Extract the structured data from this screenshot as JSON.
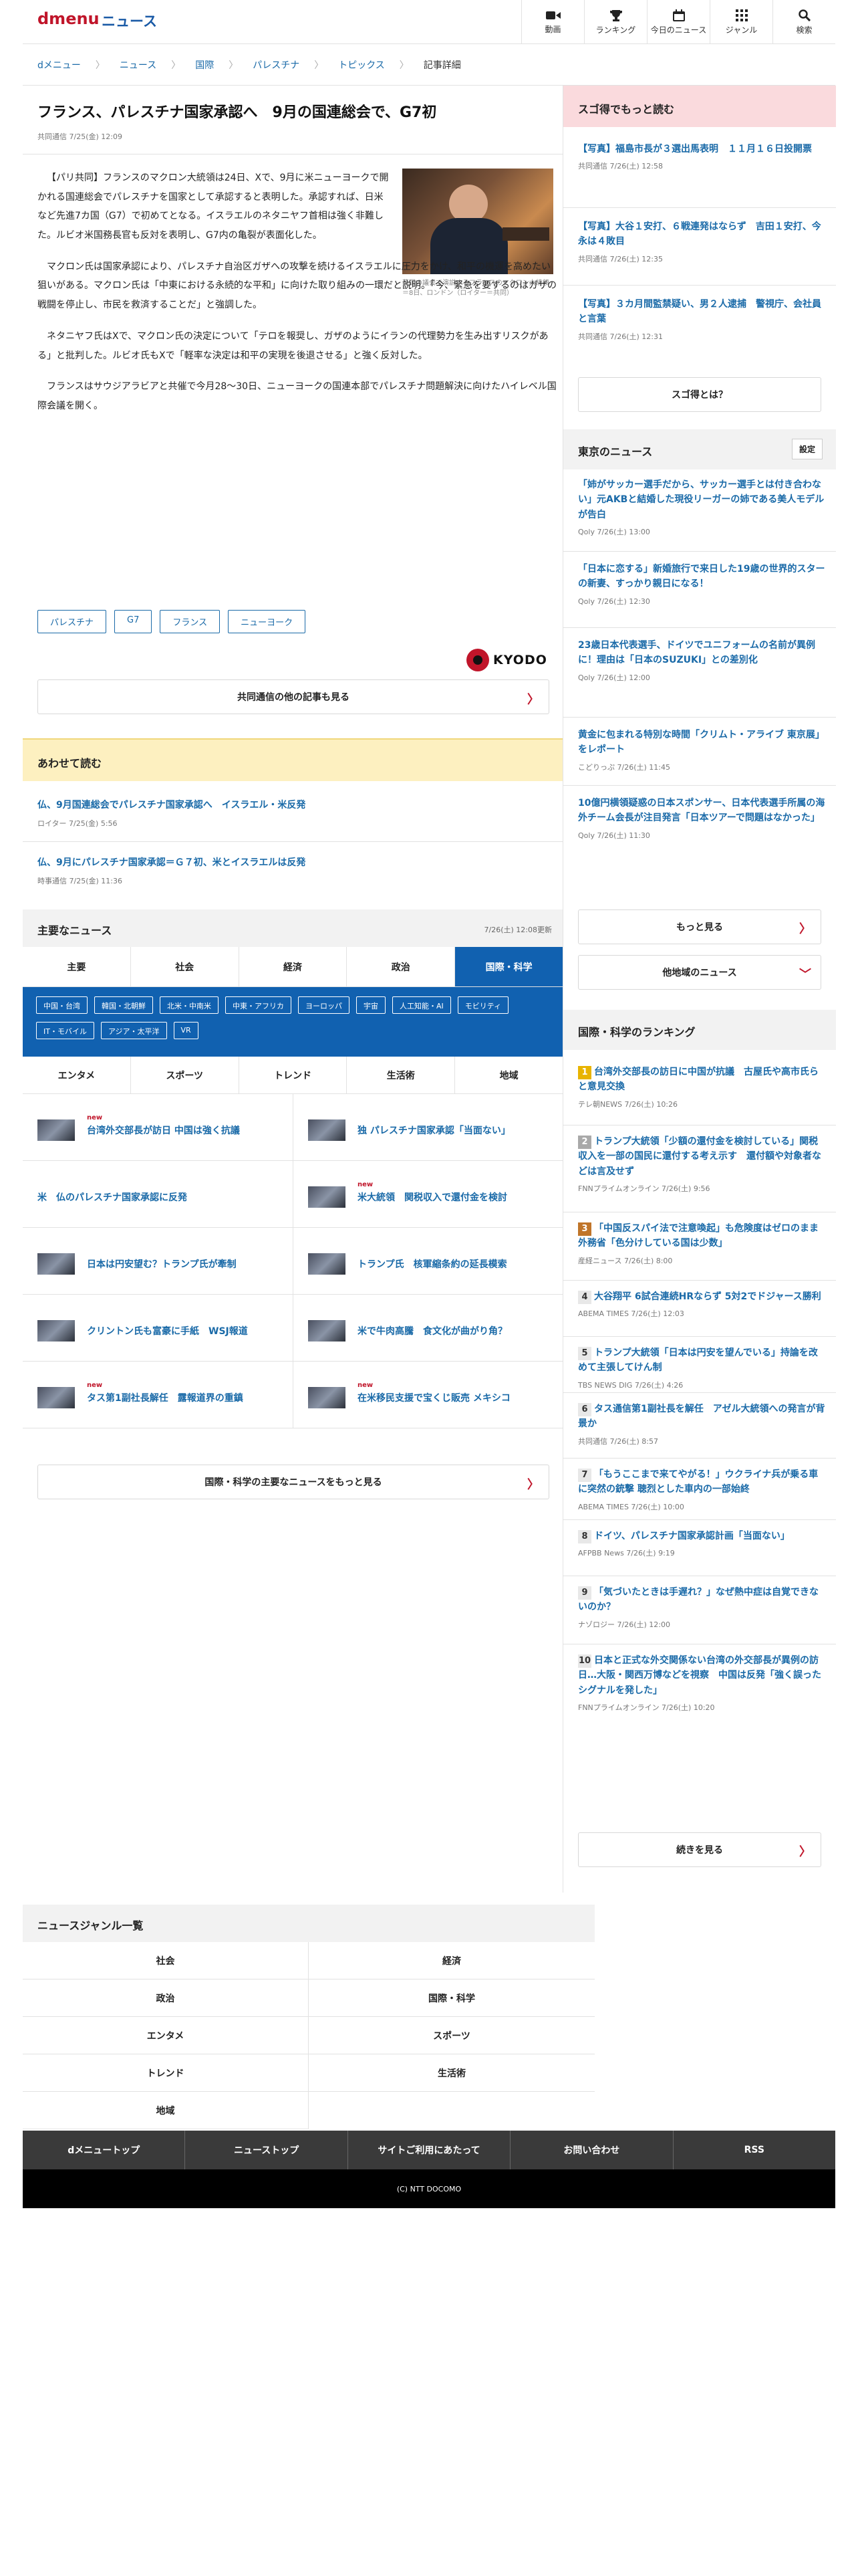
{
  "header": {
    "logo": "dmenu",
    "section": "ニュース",
    "nav": [
      {
        "label": "動画",
        "icon": "video-icon"
      },
      {
        "label": "ランキング",
        "icon": "trophy-icon"
      },
      {
        "label": "今日のニュース",
        "icon": "calendar-icon"
      },
      {
        "label": "ジャンル",
        "icon": "grid-icon"
      },
      {
        "label": "検索",
        "icon": "search-icon"
      }
    ]
  },
  "breadcrumb": [
    "dメニュー",
    "ニュース",
    "国際",
    "パレスチナ",
    "トピックス",
    "記事詳細"
  ],
  "article": {
    "title": "フランス、パレスチナ国家承認へ　9月の国連総会で、G7初",
    "meta": "共同通信 7/25(金) 12:09",
    "photo_caption": "英国の議会で演説するフランスのマクロン大統領＝8日、ロンドン（ロイター＝共同）",
    "paragraphs": [
      "【パリ共同】フランスのマクロン大統領は24日、Xで、9月に米ニューヨークで開かれる国連総会でパレスチナを国家として承認すると表明した。承認すれば、日米など先進7カ国（G7）で初めてとなる。イスラエルのネタニヤフ首相は強く非難した。ルビオ米国務長官も反対を表明し、G7内の亀裂が表面化した。",
      "マクロン氏は国家承認により、パレスチナ自治区ガザへの攻撃を続けるイスラエルに圧力をかけ、和平の機運を高めたい狙いがある。マクロン氏は「中東における永続的な平和」に向けた取り組みの一環だと説明。「今、緊急を要するのはガザの戦闘を停止し、市民を救済することだ」と強調した。",
      "ネタニヤフ氏はXで、マクロン氏の決定について「テロを報奨し、ガザのようにイランの代理勢力を生み出すリスクがある」と批判した。ルビオ氏もXで「軽率な決定は和平の実現を後退させる」と強く反対した。",
      "フランスはサウジアラビアと共催で今月28〜30日、ニューヨークの国連本部でパレスチナ問題解決に向けたハイレベル国際会議を開く。"
    ],
    "tags": [
      "パレスチナ",
      "G7",
      "フランス",
      "ニューヨーク"
    ],
    "source_logo": "KYODO",
    "more_button": "共同通信の他の記事も見る"
  },
  "related": {
    "title": "あわせて読む",
    "items": [
      {
        "title": "仏、9月国連総会でパレスチナ国家承認へ　イスラエル・米反発",
        "meta": "ロイター 7/25(金) 5:56"
      },
      {
        "title": "仏、9月にパレスチナ国家承認＝Ｇ７初、米とイスラエルは反発",
        "meta": "時事通信 7/25(金) 11:36"
      }
    ]
  },
  "major": {
    "title": "主要なニュース",
    "updated": "7/26(土) 12:08更新",
    "tabs1": [
      "主要",
      "社会",
      "経済",
      "政治",
      "国際・科学"
    ],
    "active_tab": "国際・科学",
    "subtags": [
      "中国・台湾",
      "韓国・北朝鮮",
      "北米・中南米",
      "中東・アフリカ",
      "ヨーロッパ",
      "宇宙",
      "人工知能・AI",
      "モビリティ",
      "IT・モバイル",
      "アジア・太平洋",
      "VR"
    ],
    "tabs2": [
      "エンタメ",
      "スポーツ",
      "トレンド",
      "生活術",
      "地域"
    ],
    "new_label": "new",
    "items": [
      {
        "title": "台湾外交部長が訪日 中国は強く抗議",
        "new": true,
        "thumb": true
      },
      {
        "title": "独 パレスチナ国家承認「当面ない」",
        "new": false,
        "thumb": true
      },
      {
        "title": "米　仏のパレスチナ国家承認に反発",
        "new": false,
        "thumb": false
      },
      {
        "title": "米大統領　関税収入で還付金を検討",
        "new": true,
        "thumb": true
      },
      {
        "title": "日本は円安望む？トランプ氏が牽制",
        "new": false,
        "thumb": true
      },
      {
        "title": "トランプ氏　核軍縮条約の延長模索",
        "new": false,
        "thumb": true
      },
      {
        "title": "クリントン氏も富豪に手紙　WSJ報道",
        "new": false,
        "thumb": true
      },
      {
        "title": "米で牛肉高騰　食文化が曲がり角？",
        "new": false,
        "thumb": true
      },
      {
        "title": "タス第1副社長解任　露報道界の重鎮",
        "new": true,
        "thumb": true
      },
      {
        "title": "在米移民支援で宝くじ販売 メキシコ",
        "new": true,
        "thumb": true
      }
    ],
    "more_button": "国際・科学の主要なニュースをもっと見る"
  },
  "sidebar": {
    "sugotoku": {
      "title": "スゴ得でもっと読む",
      "items": [
        {
          "title": "【写真】福島市長が３選出馬表明　１１月１６日投開票",
          "meta": "共同通信 7/26(土) 12:58"
        },
        {
          "title": "【写真】大谷１安打、６戦連発はならず　吉田１安打、今永は４敗目",
          "meta": "共同通信 7/26(土) 12:35"
        },
        {
          "title": "【写真】３カ月間監禁疑い、男２人逮捕　警視庁、会社員と言葉",
          "meta": "共同通信 7/26(土) 12:31"
        }
      ],
      "button": "スゴ得とは？"
    },
    "tokyo": {
      "title": "東京のニュース",
      "settings": "設定",
      "items": [
        {
          "title": "「姉がサッカー選手だから、サッカー選手とは付き合わない」元AKBと結婚した現役リーガーの姉である美人モデルが告白",
          "meta": "Qoly 7/26(土) 13:00"
        },
        {
          "title": "「日本に恋する」新婚旅行で来日した19歳の世界的スターの新妻、すっかり親日になる！",
          "meta": "Qoly 7/26(土) 12:30"
        },
        {
          "title": "23歳日本代表選手、ドイツでユニフォームの名前が異例に！理由は「日本のSUZUKI」との差別化",
          "meta": "Qoly 7/26(土) 12:00"
        },
        {
          "title": "黄金に包まれる特別な時間「クリムト・アライブ 東京展」をレポート",
          "meta": "こどりっぷ 7/26(土) 11:45"
        },
        {
          "title": "10億円横領疑惑の日本スポンサー、日本代表選手所属の海外チーム会長が注目発言「日本ツアーで問題はなかった」",
          "meta": "Qoly 7/26(土) 11:30"
        }
      ],
      "more_button": "もっと見る",
      "other_button": "他地域のニュース"
    },
    "ranking": {
      "title": "国際・科学のランキング",
      "items": [
        {
          "rank": "1",
          "title": "台湾外交部長の訪日に中国が抗議　古屋氏や高市氏らと意見交換",
          "meta": "テレ朝NEWS 7/26(土) 10:26"
        },
        {
          "rank": "2",
          "title": "トランプ大統領「少額の還付金を検討している」関税収入を一部の国民に還付する考え示す　還付額や対象者などは言及せず",
          "meta": "FNNプライムオンライン 7/26(土) 9:56"
        },
        {
          "rank": "3",
          "title": "「中国反スパイ法で注意喚起」も危険度はゼロのまま　外務省「色分けしている国は少数」",
          "meta": "産経ニュース 7/26(土) 8:00"
        },
        {
          "rank": "4",
          "title": "大谷翔平 6試合連続HRならず 5対2でドジャース勝利",
          "meta": "ABEMA TIMES 7/26(土) 12:03"
        },
        {
          "rank": "5",
          "title": "トランプ大統領「日本は円安を望んでいる」持論を改めて主張してけん制",
          "meta": "TBS NEWS DIG 7/26(土) 4:26"
        },
        {
          "rank": "6",
          "title": "タス通信第1副社長を解任　アゼル大統領への発言が背景か",
          "meta": "共同通信 7/26(土) 8:57"
        },
        {
          "rank": "7",
          "title": "「もうここまで来てやがる！」ウクライナ兵が乗る車に突然の銃撃 聴烈とした車内の一部始終",
          "meta": "ABEMA TIMES 7/26(土) 10:00"
        },
        {
          "rank": "8",
          "title": "ドイツ、パレスチナ国家承認計画「当面ない」",
          "meta": "AFPBB News 7/26(土) 9:19"
        },
        {
          "rank": "9",
          "title": "「気づいたときは手遅れ？」なぜ熱中症は自覚できないのか？",
          "meta": "ナゾロジー 7/26(土) 12:00"
        },
        {
          "rank": "10",
          "title": "日本と正式な外交関係ない台湾の外交部長が異例の訪日…大阪・関西万博などを視察　中国は反発「強く誤ったシグナルを発した」",
          "meta": "FNNプライムオンライン 7/26(土) 10:20"
        }
      ],
      "button": "続きを見る"
    }
  },
  "genres": {
    "title": "ニュースジャンル一覧",
    "items": [
      "社会",
      "経済",
      "政治",
      "国際・科学",
      "エンタメ",
      "スポーツ",
      "トレンド",
      "生活術",
      "地域"
    ]
  },
  "footer": {
    "links": [
      "dメニュートップ",
      "ニューストップ",
      "サイトご利用にあたって",
      "お問い合わせ",
      "RSS"
    ],
    "copyright": "(C) NTT DOCOMO"
  },
  "colors": {
    "brand_red": "#c0152a",
    "link_blue": "#1a6aa8",
    "tab_blue": "#1161b0",
    "related_yellow": "#fdf0c0",
    "sugotoku_pink": "#fadadd"
  }
}
